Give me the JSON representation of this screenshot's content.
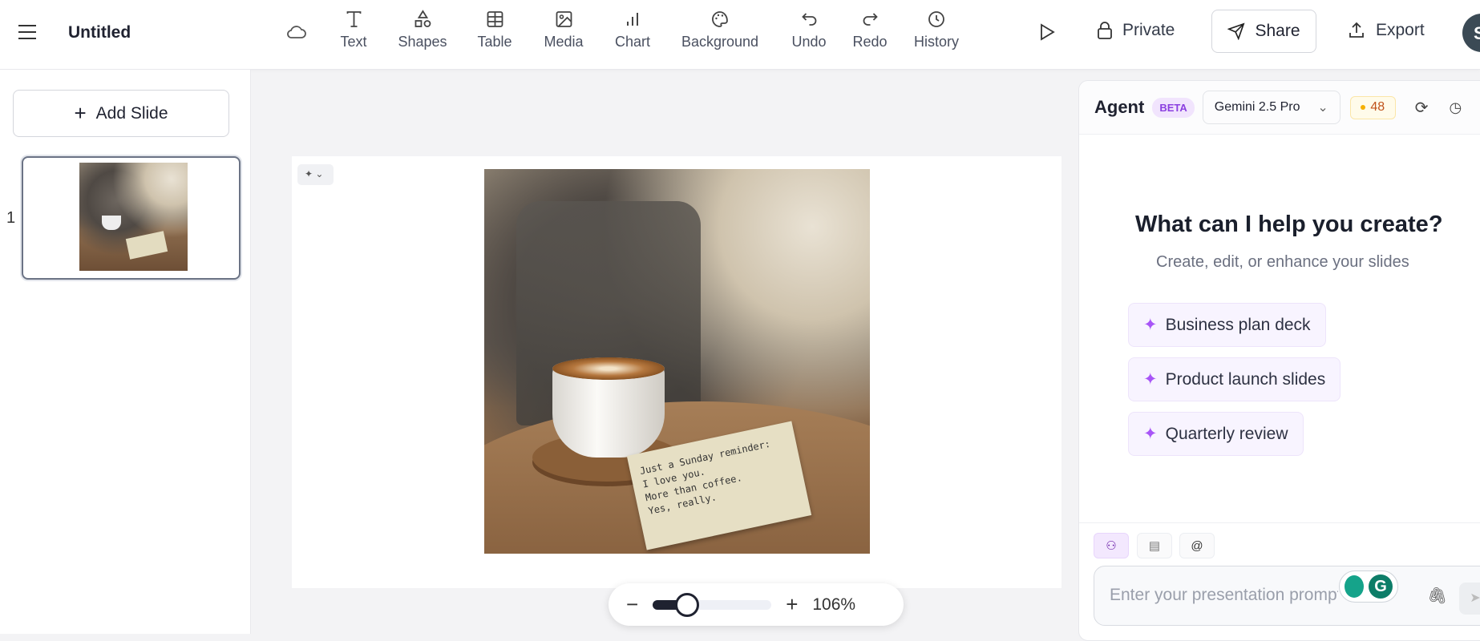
{
  "header": {
    "title": "Untitled",
    "tools": [
      {
        "label": "Text",
        "icon": "text-icon"
      },
      {
        "label": "Shapes",
        "icon": "shapes-icon"
      },
      {
        "label": "Table",
        "icon": "table-icon"
      },
      {
        "label": "Media",
        "icon": "image-icon"
      },
      {
        "label": "Chart",
        "icon": "chart-icon"
      },
      {
        "label": "Background",
        "icon": "palette-icon"
      },
      {
        "label": "Undo",
        "icon": "undo-icon"
      },
      {
        "label": "Redo",
        "icon": "redo-icon"
      },
      {
        "label": "History",
        "icon": "clock-icon"
      }
    ],
    "private_label": "Private",
    "share_label": "Share",
    "export_label": "Export",
    "avatar": "S"
  },
  "sidebar": {
    "add_slide_label": "Add Slide",
    "slides": [
      {
        "number": "1"
      }
    ]
  },
  "slide": {
    "note_lines": [
      "Just a Sunday reminder:",
      "I love you.",
      "More than coffee.",
      "Yes, really."
    ]
  },
  "zoom": {
    "value_label": "106%",
    "percent": 106
  },
  "agent": {
    "title": "Agent",
    "badge": "BETA",
    "model": "Gemini 2.5 Pro",
    "credits": "48",
    "heading": "What can I help you create?",
    "subheading": "Create, edit, or enhance your slides",
    "suggestions": [
      "Business plan deck",
      "Product launch slides",
      "Quarterly review"
    ],
    "input_placeholder": "Enter your presentation prompt",
    "accent": "#8b3fe0"
  }
}
